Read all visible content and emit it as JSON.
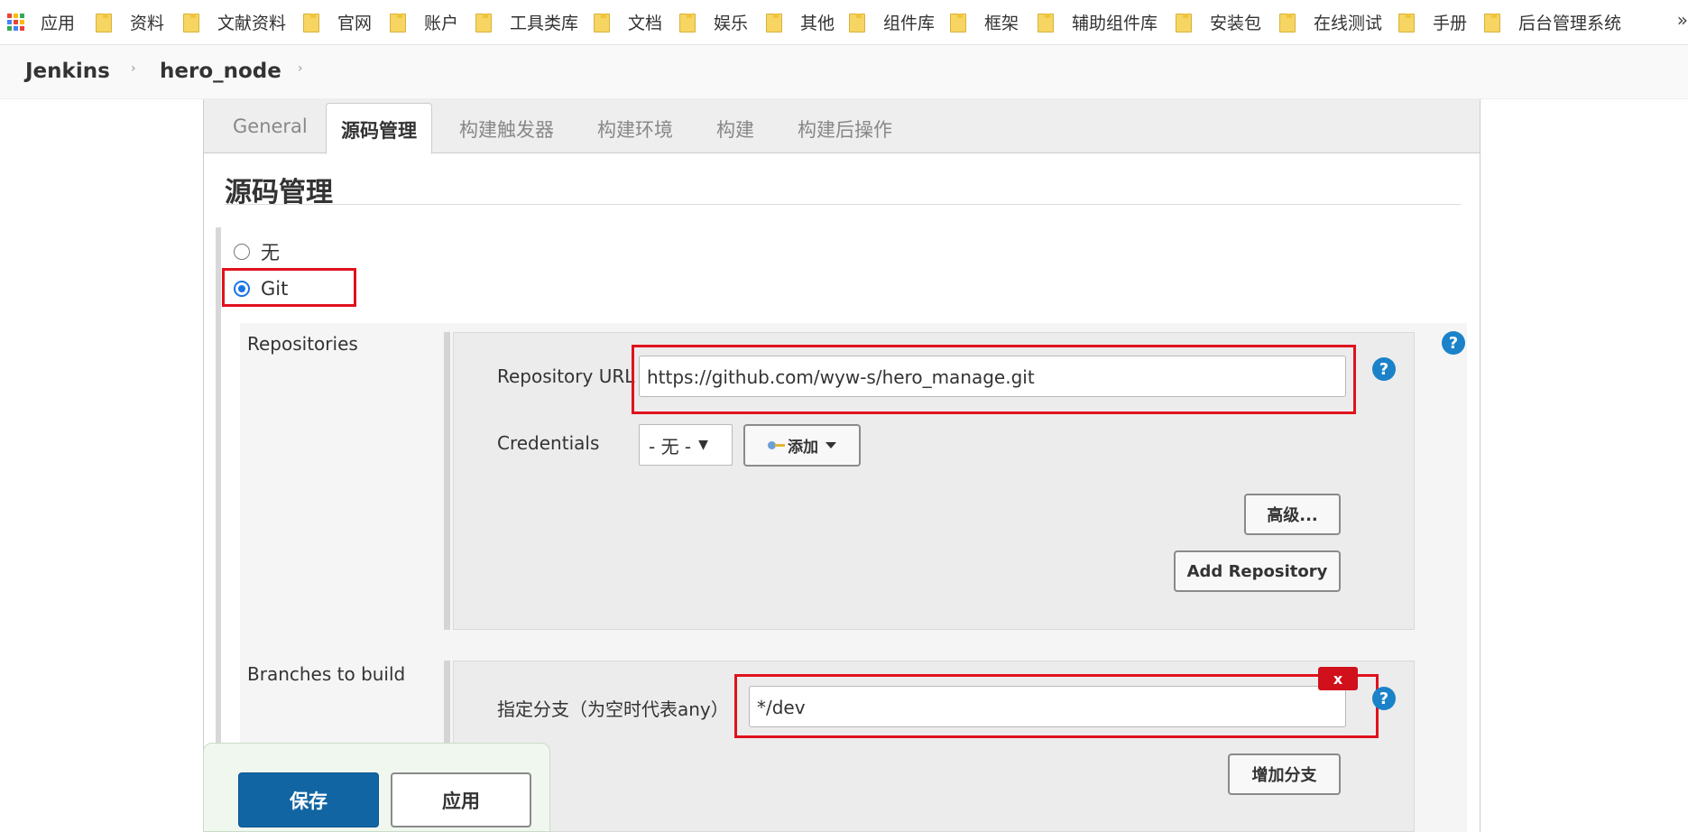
{
  "bookmarks": {
    "apps_label": "应用",
    "items": [
      "资料",
      "文献资料",
      "官网",
      "账户",
      "工具类库",
      "文档",
      "娱乐",
      "其他",
      "组件库",
      "框架",
      "辅助组件库",
      "安装包",
      "在线测试",
      "手册",
      "后台管理系统"
    ],
    "more": "»"
  },
  "breadcrumb": {
    "items": [
      "Jenkins",
      "hero_node"
    ],
    "separator": "›"
  },
  "tabs": [
    "General",
    "源码管理",
    "构建触发器",
    "构建环境",
    "构建",
    "构建后操作"
  ],
  "active_tab": "源码管理",
  "section": {
    "title": "源码管理"
  },
  "scm": {
    "option_none": "无",
    "option_git": "Git",
    "selected": "Git"
  },
  "repositories": {
    "label": "Repositories",
    "url_label": "Repository URL",
    "url_value": "https://github.com/wyw-s/hero_manage.git",
    "credentials_label": "Credentials",
    "credentials_value": "- 无 -",
    "add_label": "添加",
    "advanced_label": "高级...",
    "add_repository_label": "Add Repository",
    "help": "?"
  },
  "branches": {
    "label": "Branches to build",
    "branch_label": "指定分支（为空时代表any）",
    "branch_value": "*/dev",
    "delete_label": "x",
    "add_branch_label": "增加分支",
    "help": "?"
  },
  "actions": {
    "save_label": "保存",
    "apply_label": "应用"
  },
  "colors": {
    "highlight": "#e0121d",
    "primary": "#1265a3",
    "help": "#1b82c9",
    "radio_checked": "#1a73e8"
  }
}
